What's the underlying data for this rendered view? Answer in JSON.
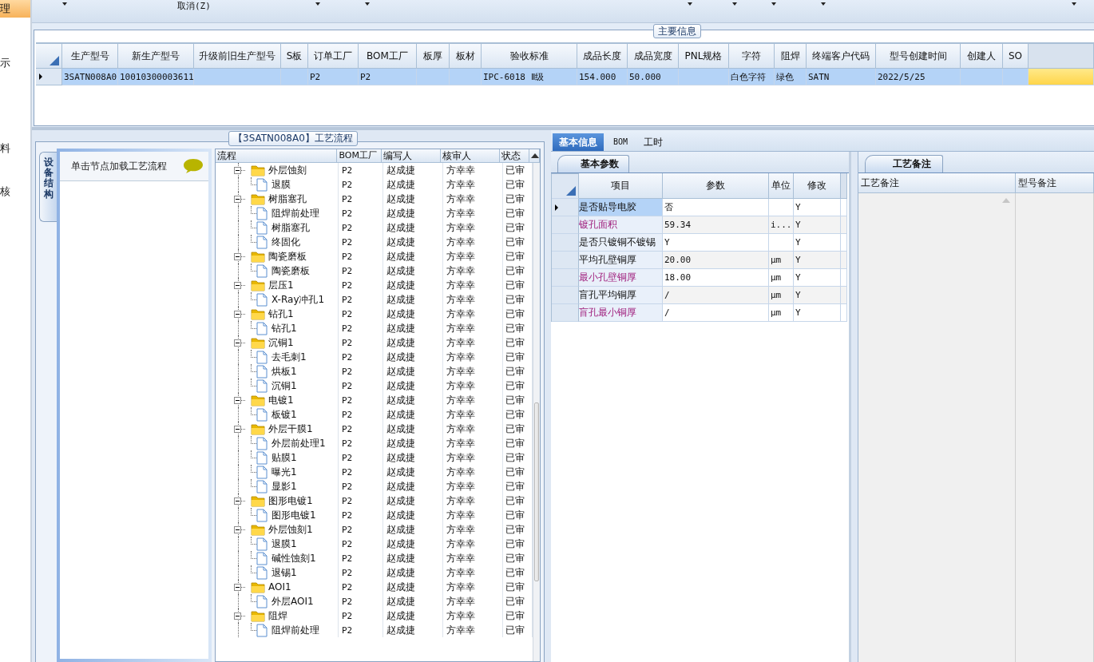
{
  "sidebar": {
    "items": [
      {
        "label": "理",
        "selected": true
      },
      {
        "label": "示",
        "selected": false
      },
      {
        "label": "料",
        "selected": false
      },
      {
        "label": "核",
        "selected": false
      }
    ]
  },
  "toolbar": {
    "cancel_label": "取消(Z)"
  },
  "main_info": {
    "title": "主要信息",
    "columns": [
      "生产型号",
      "新生产型号",
      "升级前旧生产型号",
      "S板",
      "订单工厂",
      "BOM工厂",
      "板厚",
      "板材",
      "验收标准",
      "成品长度",
      "成品宽度",
      "PNL规格",
      "字符",
      "阻焊",
      "终端客户代码",
      "型号创建时间",
      "创建人",
      "SO"
    ],
    "rows": [
      {
        "selected": true,
        "cells": [
          "3SATN008A0",
          "10010300003611",
          null,
          null,
          "P2",
          "P2",
          null,
          null,
          "IPC-6018 Ⅱ级",
          "154.000",
          "50.000",
          null,
          "白色字符",
          "绿色",
          "SATN",
          "2022/5/25",
          null,
          null
        ]
      }
    ]
  },
  "process": {
    "title": "【3SATN008A0】工艺流程",
    "side_tab": "设备结构",
    "hint": "单击节点加载工艺流程",
    "columns": [
      "流程",
      "BOM工厂",
      "编写人",
      "核审人",
      "状态"
    ],
    "nodes": [
      {
        "label": "外层蚀刻",
        "bom": "P2",
        "writer": "赵成捷",
        "reviewer": "方幸幸",
        "status": "已审",
        "expanded": true,
        "children": [
          {
            "label": "退膜",
            "bom": "P2",
            "writer": "赵成捷",
            "reviewer": "方幸幸",
            "status": "已审"
          }
        ]
      },
      {
        "label": "树脂塞孔",
        "bom": "P2",
        "writer": "赵成捷",
        "reviewer": "方幸幸",
        "status": "已审",
        "expanded": true,
        "children": [
          {
            "label": "阻焊前处理",
            "bom": "P2",
            "writer": "赵成捷",
            "reviewer": "方幸幸",
            "status": "已审"
          },
          {
            "label": "树脂塞孔",
            "bom": "P2",
            "writer": "赵成捷",
            "reviewer": "方幸幸",
            "status": "已审"
          },
          {
            "label": "终固化",
            "bom": "P2",
            "writer": "赵成捷",
            "reviewer": "方幸幸",
            "status": "已审"
          }
        ]
      },
      {
        "label": "陶瓷磨板",
        "bom": "P2",
        "writer": "赵成捷",
        "reviewer": "方幸幸",
        "status": "已审",
        "expanded": true,
        "children": [
          {
            "label": "陶瓷磨板",
            "bom": "P2",
            "writer": "赵成捷",
            "reviewer": "方幸幸",
            "status": "已审"
          }
        ]
      },
      {
        "label": "层压1",
        "bom": "P2",
        "writer": "赵成捷",
        "reviewer": "方幸幸",
        "status": "已审",
        "expanded": true,
        "children": [
          {
            "label": "X-Ray冲孔1",
            "bom": "P2",
            "writer": "赵成捷",
            "reviewer": "方幸幸",
            "status": "已审"
          }
        ]
      },
      {
        "label": "钻孔1",
        "bom": "P2",
        "writer": "赵成捷",
        "reviewer": "方幸幸",
        "status": "已审",
        "expanded": true,
        "children": [
          {
            "label": "钻孔1",
            "bom": "P2",
            "writer": "赵成捷",
            "reviewer": "方幸幸",
            "status": "已审"
          }
        ]
      },
      {
        "label": "沉铜1",
        "bom": "P2",
        "writer": "赵成捷",
        "reviewer": "方幸幸",
        "status": "已审",
        "expanded": true,
        "children": [
          {
            "label": "去毛刺1",
            "bom": "P2",
            "writer": "赵成捷",
            "reviewer": "方幸幸",
            "status": "已审"
          },
          {
            "label": "烘板1",
            "bom": "P2",
            "writer": "赵成捷",
            "reviewer": "方幸幸",
            "status": "已审"
          },
          {
            "label": "沉铜1",
            "bom": "P2",
            "writer": "赵成捷",
            "reviewer": "方幸幸",
            "status": "已审"
          }
        ]
      },
      {
        "label": "电镀1",
        "bom": "P2",
        "writer": "赵成捷",
        "reviewer": "方幸幸",
        "status": "已审",
        "expanded": true,
        "children": [
          {
            "label": "板镀1",
            "bom": "P2",
            "writer": "赵成捷",
            "reviewer": "方幸幸",
            "status": "已审"
          }
        ]
      },
      {
        "label": "外层干膜1",
        "bom": "P2",
        "writer": "赵成捷",
        "reviewer": "方幸幸",
        "status": "已审",
        "expanded": true,
        "children": [
          {
            "label": "外层前处理1",
            "bom": "P2",
            "writer": "赵成捷",
            "reviewer": "方幸幸",
            "status": "已审"
          },
          {
            "label": "贴膜1",
            "bom": "P2",
            "writer": "赵成捷",
            "reviewer": "方幸幸",
            "status": "已审"
          },
          {
            "label": "曝光1",
            "bom": "P2",
            "writer": "赵成捷",
            "reviewer": "方幸幸",
            "status": "已审"
          },
          {
            "label": "显影1",
            "bom": "P2",
            "writer": "赵成捷",
            "reviewer": "方幸幸",
            "status": "已审"
          }
        ]
      },
      {
        "label": "图形电镀1",
        "bom": "P2",
        "writer": "赵成捷",
        "reviewer": "方幸幸",
        "status": "已审",
        "expanded": true,
        "children": [
          {
            "label": "图形电镀1",
            "bom": "P2",
            "writer": "赵成捷",
            "reviewer": "方幸幸",
            "status": "已审"
          }
        ]
      },
      {
        "label": "外层蚀刻1",
        "bom": "P2",
        "writer": "赵成捷",
        "reviewer": "方幸幸",
        "status": "已审",
        "expanded": true,
        "children": [
          {
            "label": "退膜1",
            "bom": "P2",
            "writer": "赵成捷",
            "reviewer": "方幸幸",
            "status": "已审"
          },
          {
            "label": "碱性蚀刻1",
            "bom": "P2",
            "writer": "赵成捷",
            "reviewer": "方幸幸",
            "status": "已审"
          },
          {
            "label": "退锡1",
            "bom": "P2",
            "writer": "赵成捷",
            "reviewer": "方幸幸",
            "status": "已审"
          }
        ]
      },
      {
        "label": "AOI1",
        "bom": "P2",
        "writer": "赵成捷",
        "reviewer": "方幸幸",
        "status": "已审",
        "expanded": true,
        "children": [
          {
            "label": "外层AOI1",
            "bom": "P2",
            "writer": "赵成捷",
            "reviewer": "方幸幸",
            "status": "已审"
          }
        ]
      },
      {
        "label": "阻焊",
        "bom": "P2",
        "writer": "赵成捷",
        "reviewer": "方幸幸",
        "status": "已审",
        "expanded": true,
        "children": [
          {
            "label": "阻焊前处理",
            "bom": "P2",
            "writer": "赵成捷",
            "reviewer": "方幸幸",
            "status": "已审"
          }
        ]
      }
    ]
  },
  "detail_tabs": [
    {
      "label": "基本信息",
      "selected": true
    },
    {
      "label": "BOM",
      "selected": false
    },
    {
      "label": "工时",
      "selected": false
    }
  ],
  "basic_params": {
    "tab": "基本参数",
    "columns": [
      "项目",
      "参数",
      "单位",
      "修改"
    ],
    "rows": [
      {
        "item": "是否贴导电胶",
        "value": "否",
        "modify": "Y",
        "highlighted": false,
        "selected": true
      },
      {
        "item": "镀孔面积",
        "value": "59.34",
        "unit": "i...",
        "modify": "Y",
        "highlighted": true,
        "selected": false
      },
      {
        "item": "是否只镀铜不镀锡",
        "value": "Y",
        "modify": "Y",
        "highlighted": false,
        "selected": false
      },
      {
        "item": "平均孔壁铜厚",
        "value": "20.00",
        "unit": "μm",
        "modify": "Y",
        "highlighted": false,
        "selected": false
      },
      {
        "item": "最小孔壁铜厚",
        "value": "18.00",
        "unit": "μm",
        "modify": "Y",
        "highlighted": true,
        "selected": false
      },
      {
        "item": "盲孔平均铜厚",
        "value": "/",
        "unit": "μm",
        "modify": "Y",
        "highlighted": false,
        "selected": false
      },
      {
        "item": "盲孔最小铜厚",
        "value": "/",
        "unit": "μm",
        "modify": "Y",
        "highlighted": true,
        "selected": false
      }
    ]
  },
  "process_notes": {
    "tab": "工艺备注",
    "columns": [
      "工艺备注",
      "型号备注"
    ]
  }
}
